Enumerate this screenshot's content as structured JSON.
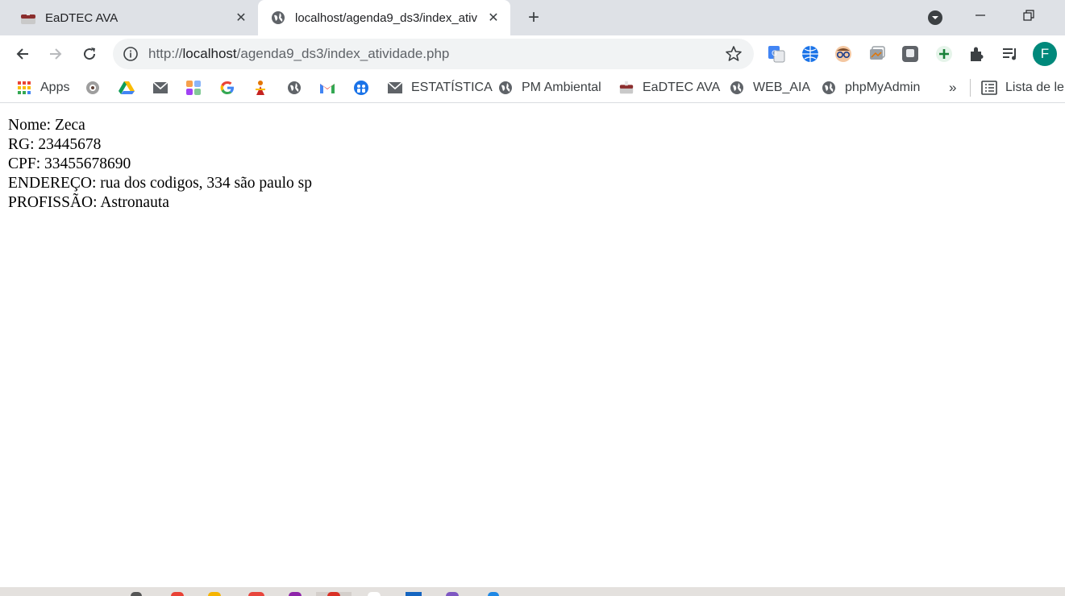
{
  "tabs": [
    {
      "title": "EaDTEC AVA",
      "active": false
    },
    {
      "title": "localhost/agenda9_ds3/index_ativ",
      "active": true
    }
  ],
  "newtab_glyph": "+",
  "close_glyph": "✕",
  "address": {
    "scheme": "http://",
    "host": "localhost",
    "path": "/agenda9_ds3/index_atividade.php"
  },
  "profile_initial": "F",
  "bookmarks": [
    {
      "label": "Apps",
      "icon": "apps-grid-icon"
    },
    {
      "label": "",
      "icon": "eye-icon"
    },
    {
      "label": "",
      "icon": "google-drive-icon"
    },
    {
      "label": "",
      "icon": "mail-icon"
    },
    {
      "label": "",
      "icon": "puzzle-tile-icon"
    },
    {
      "label": "",
      "icon": "google-icon"
    },
    {
      "label": "",
      "icon": "figure-icon"
    },
    {
      "label": "",
      "icon": "globe-icon"
    },
    {
      "label": "",
      "icon": "gmail-icon"
    },
    {
      "label": "",
      "icon": "people-icon"
    },
    {
      "label": "ESTATÍSTICA",
      "icon": "mail-icon"
    },
    {
      "label": "PM Ambiental",
      "icon": "globe-icon"
    },
    {
      "label": "EaDTEC AVA",
      "icon": "cake-icon"
    },
    {
      "label": "WEB_AIA",
      "icon": "globe-icon"
    },
    {
      "label": "phpMyAdmin",
      "icon": "globe-icon"
    }
  ],
  "bookmarks_overflow": "»",
  "reading_list_label": "Lista de lei",
  "page": {
    "lines": [
      "Nome: Zeca",
      "RG: 23445678",
      "CPF: 33455678690",
      "ENDEREÇO: rua dos codigos, 334 são paulo sp",
      "PROFISSÃO: Astronauta"
    ]
  },
  "colors": {
    "tabstrip": "#dee1e6",
    "profile_avatar": "#00897b",
    "link_blue": "#1a73e8"
  }
}
